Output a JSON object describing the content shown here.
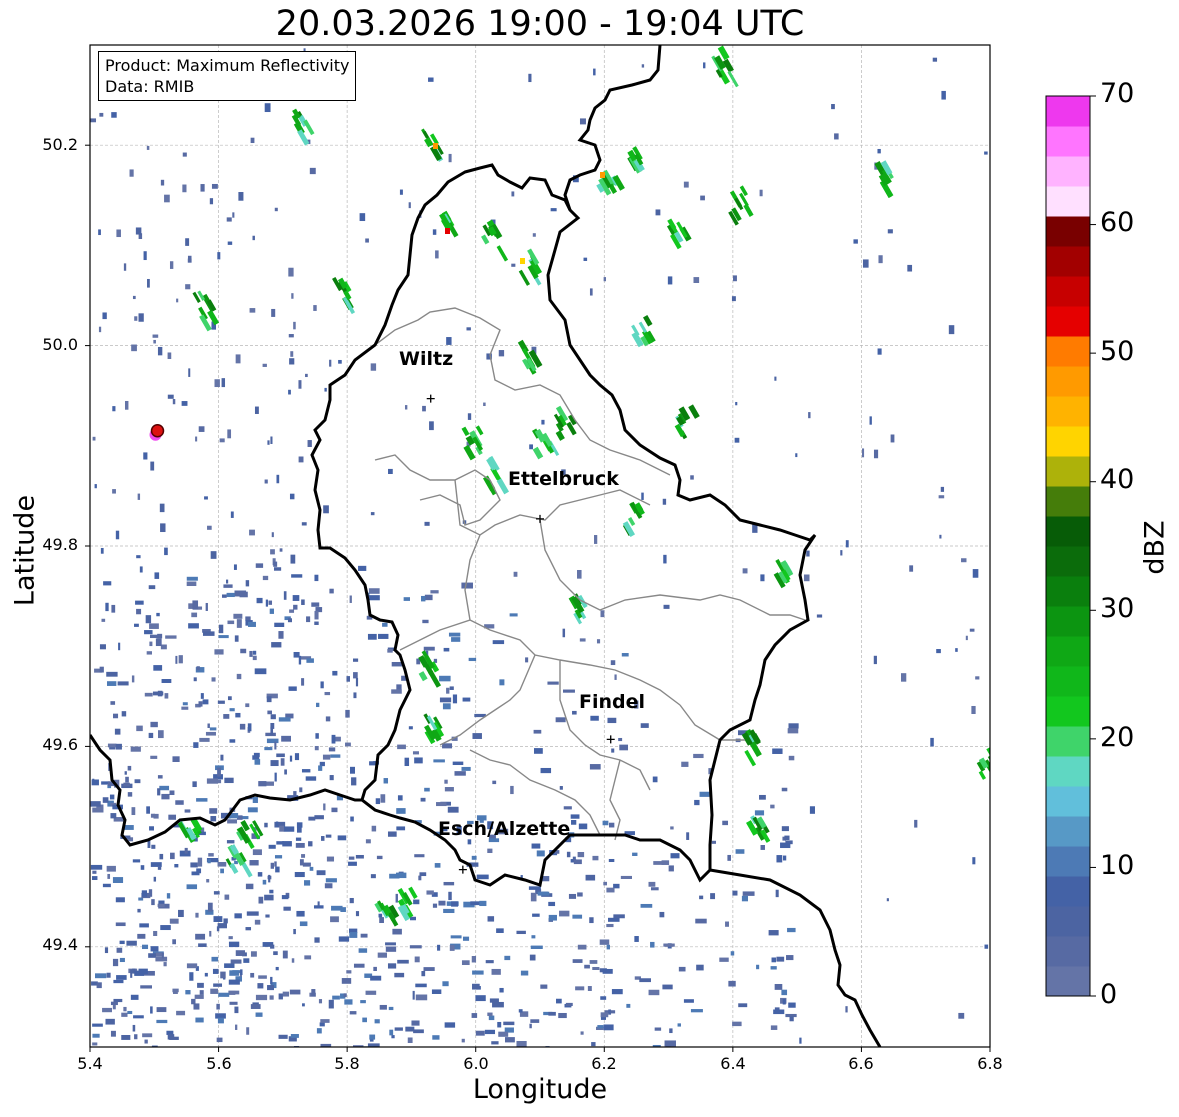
{
  "title": "20.03.2026 19:00 - 19:04 UTC",
  "info_box": {
    "product": "Product: Maximum Reflectivity",
    "data": "Data: RMIB"
  },
  "xlabel": "Longitude",
  "ylabel": "Latitude",
  "x_ticks": [
    "5.4",
    "5.6",
    "5.8",
    "6.0",
    "6.2",
    "6.4",
    "6.6",
    "6.8"
  ],
  "y_ticks": [
    "49.4",
    "49.6",
    "49.8",
    "50.0",
    "50.2"
  ],
  "colorbar": {
    "label": "dBZ",
    "ticks": [
      "0",
      "10",
      "20",
      "30",
      "40",
      "50",
      "60",
      "70"
    ],
    "range": [
      0,
      70
    ],
    "colors": [
      "#6474a7",
      "#576aa3",
      "#4c64a2",
      "#4462a6",
      "#4d7ab5",
      "#5799c6",
      "#61bfdb",
      "#5fd7c2",
      "#3fd46a",
      "#12c71e",
      "#10b71a",
      "#0fa815",
      "#0c9511",
      "#0a7f0d",
      "#0b6c0b",
      "#075c07",
      "#457d0a",
      "#adb20a",
      "#ffd400",
      "#ffb300",
      "#ff9a00",
      "#ff7b00",
      "#e50000",
      "#c70000",
      "#a20000",
      "#790000",
      "#ffe0ff",
      "#ffb3ff",
      "#ff75ff",
      "#ee38ee"
    ]
  },
  "map": {
    "extent": {
      "lon": [
        5.4,
        6.8
      ],
      "lat": [
        49.3,
        50.3
      ]
    },
    "grid": true,
    "cities": [
      {
        "name": "Wiltz",
        "lon": 5.93,
        "lat": 49.97
      },
      {
        "name": "Ettelbruck",
        "lon": 6.1,
        "lat": 49.85
      },
      {
        "name": "Findel",
        "lon": 6.21,
        "lat": 49.63
      },
      {
        "name": "Esch/Alzette",
        "lon": 5.98,
        "lat": 49.5
      }
    ],
    "radar_site": {
      "lon": 5.505,
      "lat": 49.915
    }
  }
}
